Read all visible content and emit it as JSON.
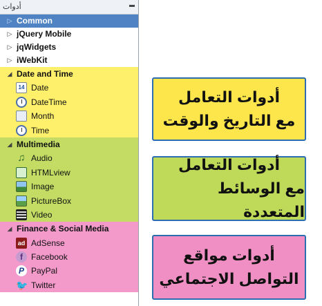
{
  "panel": {
    "title": "أدوات",
    "groups": [
      {
        "label": "Common",
        "selected": true,
        "expanded": false
      },
      {
        "label": "jQuery Mobile",
        "expanded": false
      },
      {
        "label": "jqWidgets",
        "expanded": false
      },
      {
        "label": "iWebKit",
        "expanded": false
      }
    ],
    "date_time": {
      "label": "Date and Time",
      "items": [
        {
          "label": "Date",
          "icon": "calendar-icon",
          "badge": "14"
        },
        {
          "label": "DateTime",
          "icon": "clock-icon"
        },
        {
          "label": "Month",
          "icon": "calendar-month-icon"
        },
        {
          "label": "Time",
          "icon": "clock-icon"
        }
      ]
    },
    "multimedia": {
      "label": "Multimedia",
      "items": [
        {
          "label": "Audio",
          "icon": "music-note-icon"
        },
        {
          "label": "HTMLview",
          "icon": "html-view-icon"
        },
        {
          "label": "Image",
          "icon": "image-icon"
        },
        {
          "label": "PictureBox",
          "icon": "picturebox-icon"
        },
        {
          "label": "Video",
          "icon": "video-film-icon"
        }
      ]
    },
    "finance_social": {
      "label": "Finance & Social Media",
      "items": [
        {
          "label": "AdSense",
          "icon": "adsense-icon",
          "badge": "ad"
        },
        {
          "label": "Facebook",
          "icon": "facebook-icon",
          "badge": "f"
        },
        {
          "label": "PayPal",
          "icon": "paypal-icon",
          "badge": "P"
        },
        {
          "label": "Twitter",
          "icon": "twitter-bird-icon"
        }
      ]
    }
  },
  "callouts": [
    {
      "line1": "أدوات التعامل",
      "line2": "مع التاريخ والوقت",
      "color": "#fde64b"
    },
    {
      "line1": "أدوات التعامل",
      "line2": "مع الوسائط المتعددة",
      "color": "#bfd958"
    },
    {
      "line1": "أدوات مواقع",
      "line2": "التواصل الاجتماعي",
      "color": "#f08fc4"
    }
  ],
  "colors": {
    "selected": "#4f83c4",
    "date_section": "#fff06b",
    "media_section": "#c4dc63",
    "finance_section": "#f39acb",
    "callout_border": "#2c6cb0"
  }
}
